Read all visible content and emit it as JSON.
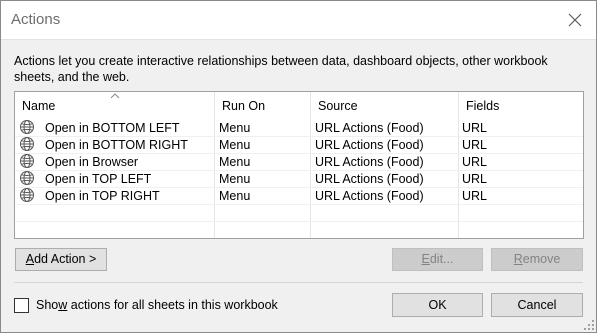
{
  "window": {
    "title": "Actions",
    "close_icon": "close-icon"
  },
  "description": "Actions let you create interactive relationships between data, dashboard objects, other workbook sheets, and the web.",
  "table": {
    "columns": [
      "Name",
      "Run On",
      "Source",
      "Fields"
    ],
    "sorted_column": "Name",
    "rows": [
      {
        "icon": "globe-icon",
        "name": "Open in BOTTOM LEFT",
        "run_on": "Menu",
        "source": "URL Actions (Food)",
        "fields": "URL"
      },
      {
        "icon": "globe-icon",
        "name": "Open in BOTTOM RIGHT",
        "run_on": "Menu",
        "source": "URL Actions (Food)",
        "fields": "URL"
      },
      {
        "icon": "globe-icon",
        "name": "Open in Browser",
        "run_on": "Menu",
        "source": "URL Actions (Food)",
        "fields": "URL"
      },
      {
        "icon": "globe-icon",
        "name": "Open in TOP LEFT",
        "run_on": "Menu",
        "source": "URL Actions (Food)",
        "fields": "URL"
      },
      {
        "icon": "globe-icon",
        "name": "Open in TOP RIGHT",
        "run_on": "Menu",
        "source": "URL Actions (Food)",
        "fields": "URL"
      }
    ]
  },
  "buttons": {
    "add_action": {
      "mnemonic": "A",
      "rest": "dd Action >"
    },
    "edit": {
      "mnemonic": "E",
      "rest": "dit..."
    },
    "remove": {
      "mnemonic": "R",
      "rest": "emove"
    },
    "ok": "OK",
    "cancel": "Cancel"
  },
  "checkbox": {
    "before": "Sho",
    "mnemonic": "w",
    "after": " actions for all sheets in this workbook",
    "checked": false
  },
  "colors": {
    "background": "#f0f0f0",
    "title_text": "#6d6d6d",
    "disabled_text": "#838383"
  }
}
